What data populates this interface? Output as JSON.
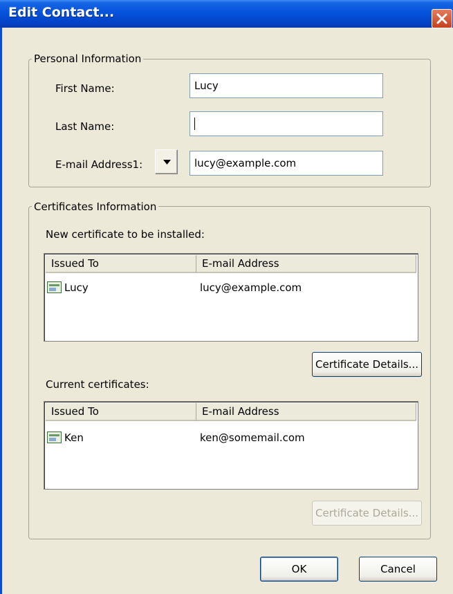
{
  "window": {
    "title": "Edit Contact..."
  },
  "personal": {
    "legend": "Personal Information",
    "first_name_label": "First Name:",
    "first_name_value": "Lucy",
    "last_name_label": "Last Name:",
    "last_name_value": "",
    "email_label": "E-mail Address1:",
    "email_value": "lucy@example.com"
  },
  "certificates": {
    "legend": "Certificates Information",
    "new_label": "New certificate to be installed:",
    "current_label": "Current certificates:",
    "columns": [
      "Issued To",
      "E-mail Address"
    ],
    "new_rows": [
      {
        "issued_to": "Lucy",
        "email": "lucy@example.com"
      }
    ],
    "current_rows": [
      {
        "issued_to": "Ken",
        "email": "ken@somemail.com"
      }
    ],
    "details_button": "Certificate Details...",
    "details_button_disabled": "Certificate Details..."
  },
  "buttons": {
    "ok": "OK",
    "cancel": "Cancel"
  },
  "colors": {
    "titlebar": "#0553dc",
    "face": "#ece9d8",
    "close": "#c6401e"
  },
  "icons": {
    "close": "close-icon",
    "dropdown": "dropdown-arrow-icon",
    "certificate": "certificate-icon"
  }
}
